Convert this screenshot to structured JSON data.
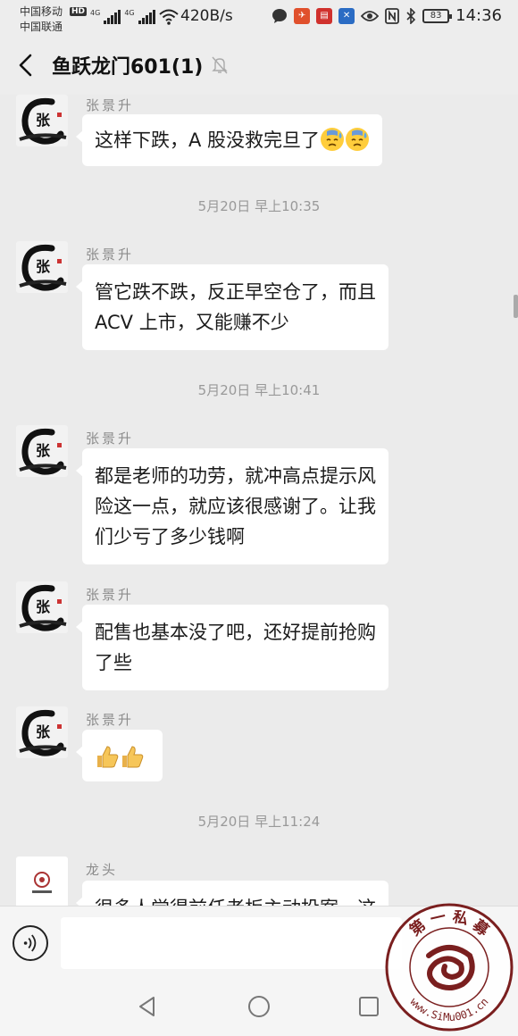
{
  "status_bar": {
    "carrier1": "中国移动",
    "carrier2": "中国联通",
    "hd": "HD",
    "sig1": "4G",
    "sig2": "4G",
    "net_speed": "420B/s",
    "battery": "83",
    "time": "14:36"
  },
  "header": {
    "title": "鱼跃龙门601(1)"
  },
  "messages": [
    {
      "sender": "张景升",
      "lines": [
        "这样下跌，A 股没救完旦了"
      ]
    },
    {
      "timestamp": "5月20日 早上10:35"
    },
    {
      "sender": "张景升",
      "lines": [
        "管它跌不跌，反正早空仓了，而且",
        "ACV 上市，又能赚不少"
      ]
    },
    {
      "timestamp": "5月20日 早上10:41"
    },
    {
      "sender": "张景升",
      "lines": [
        "都是老师的功劳，就冲高点提示风",
        "险这一点，就应该很感谢了。让我",
        "们少亏了多少钱啊"
      ]
    },
    {
      "sender": "张景升",
      "lines": [
        "配售也基本没了吧，还好提前抢购",
        "了些"
      ]
    },
    {
      "sender": "张景升",
      "lines": []
    },
    {
      "timestamp": "5月20日 早上11:24"
    },
    {
      "sender": "龙头",
      "lines": [
        "很多人觉得前任老板主动投案，这"
      ]
    }
  ],
  "input": {
    "placeholder": ""
  },
  "watermark": {
    "chars_top": "第 一 私 募",
    "url": "www.SiMu001.cn"
  },
  "colors": {
    "background": "#ebebeb",
    "bubble": "#ffffff",
    "watermark": "#7a1f1f"
  }
}
